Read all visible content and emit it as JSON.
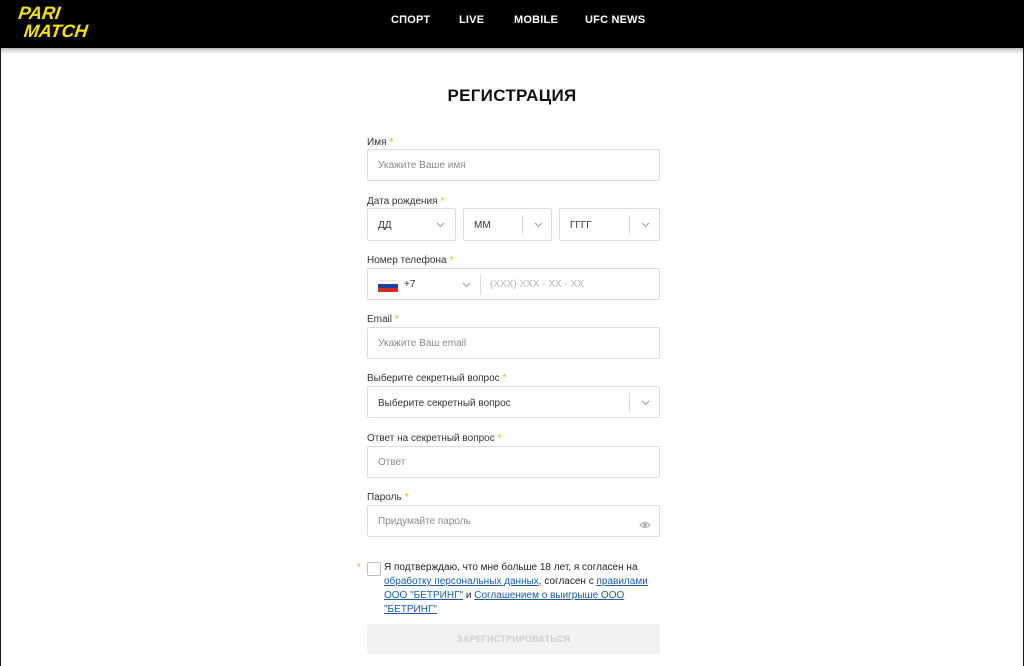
{
  "header": {
    "logo_line1": "PARI",
    "logo_line2": "MATCH",
    "nav": [
      "СПОРТ",
      "LIVE",
      "MOBILE",
      "UFC NEWS"
    ]
  },
  "form": {
    "title": "РЕГИСТРАЦИЯ",
    "required_mark": "*",
    "name": {
      "label": "Имя",
      "placeholder": "Укажите Ваше имя"
    },
    "dob": {
      "label": "Дата рождения",
      "day": "ДД",
      "month": "ММ",
      "year": "ГГГГ"
    },
    "phone": {
      "label": "Номер телефона",
      "code": "+7",
      "placeholder": "(XXX) XXX - XX - XX"
    },
    "email": {
      "label": "Email",
      "placeholder": "Укажите Ваш email"
    },
    "secret_question": {
      "label": "Выберите секретный вопрос",
      "value": "Выберите секретный вопрос"
    },
    "secret_answer": {
      "label": "Ответ на секретный вопрос",
      "placeholder": "Ответ"
    },
    "password": {
      "label": "Пароль",
      "placeholder": "Придумайте пароль"
    },
    "terms": {
      "text1": "Я подтверждаю, что мне больше 18 лет, я согласен на ",
      "link1": "обработку персональных данных",
      "text2": ", согласен с ",
      "link2": "правилами ООО \"БЕТРИНГ\"",
      "text3": " и ",
      "link3": "Соглашением о выигрыше ООО \"БЕТРИНГ\""
    },
    "submit_label": "ЗАРЕГИСТРИРОВАТЬСЯ"
  },
  "colors": {
    "brand_yellow": "#f5e100",
    "header_bg": "#000000",
    "required": "#f2b000",
    "link": "#1a5ca8"
  },
  "icons": [
    "chevron-down-icon",
    "eye-icon",
    "russia-flag-icon"
  ]
}
